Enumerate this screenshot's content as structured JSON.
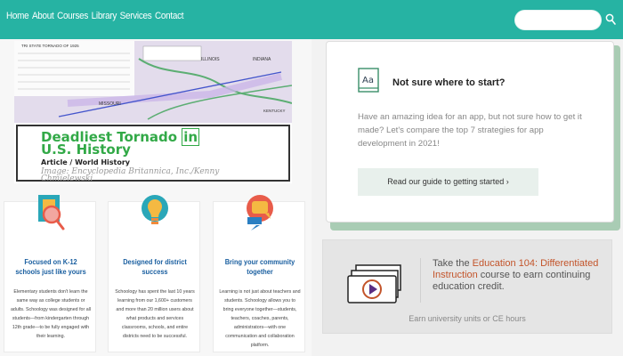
{
  "nav": {
    "links": [
      "Home",
      "About",
      "Courses",
      "Library",
      "Services",
      "Contact"
    ],
    "search_placeholder": ""
  },
  "article": {
    "map_labels": {
      "missouri": "MISSOURI",
      "illinois": "ILLINOIS",
      "indiana": "INDIANA",
      "kentucky": "KENTUCKY",
      "legend_title": "TRI STATE TORNADO OF 1925"
    },
    "headline_part1": "Deadliest Tornado ",
    "headline_boxed": "in",
    "headline_part2": "U.S. History",
    "subhead": "Article / World History",
    "credit": "Image: Encyclopedia Britannica, Inc./Kenny Chmielewski"
  },
  "features": [
    {
      "title": "Focused on K-12 schools just like yours",
      "body": "Elementary students don't learn the same way as college students or adults. Schoology was designed for all students—from kindergarten through 12th grade—to be fully engaged with their learning.",
      "icon": "magnifier-icon"
    },
    {
      "title": "Designed for district success",
      "body": "Schoology has spent the last 10 years learning from our 1,600+ customers and more than 20 million users about what products and services classrooms, schools, and entire districts need to be successful.",
      "icon": "lightbulb-icon"
    },
    {
      "title": "Bring your community together",
      "body": "Learning is not just about teachers and students. Schoology allows you to bring everyone together—students, teachers, coaches, parents, administrators—with one communication and collaboration platform.",
      "icon": "chat-icon"
    }
  ],
  "guide_card": {
    "title": "Not sure where to start?",
    "body": "Have an amazing idea for an app, but not sure how to get it made? Let's compare the top 7 strategies for app development in 2021!",
    "button": "Read our guide to getting started ›",
    "icon_text": "Aa"
  },
  "course_card": {
    "line1": "Take the ",
    "course_name": "Education 104: Differentiated Instruction",
    "line2": " course to earn continuing education credit.",
    "footer": "Earn university units or CE hours"
  },
  "colors": {
    "nav_bg": "#26b3a3",
    "headline_green": "#32a947",
    "feature_title_blue": "#1a5fa0",
    "course_accent": "#c3542a"
  }
}
